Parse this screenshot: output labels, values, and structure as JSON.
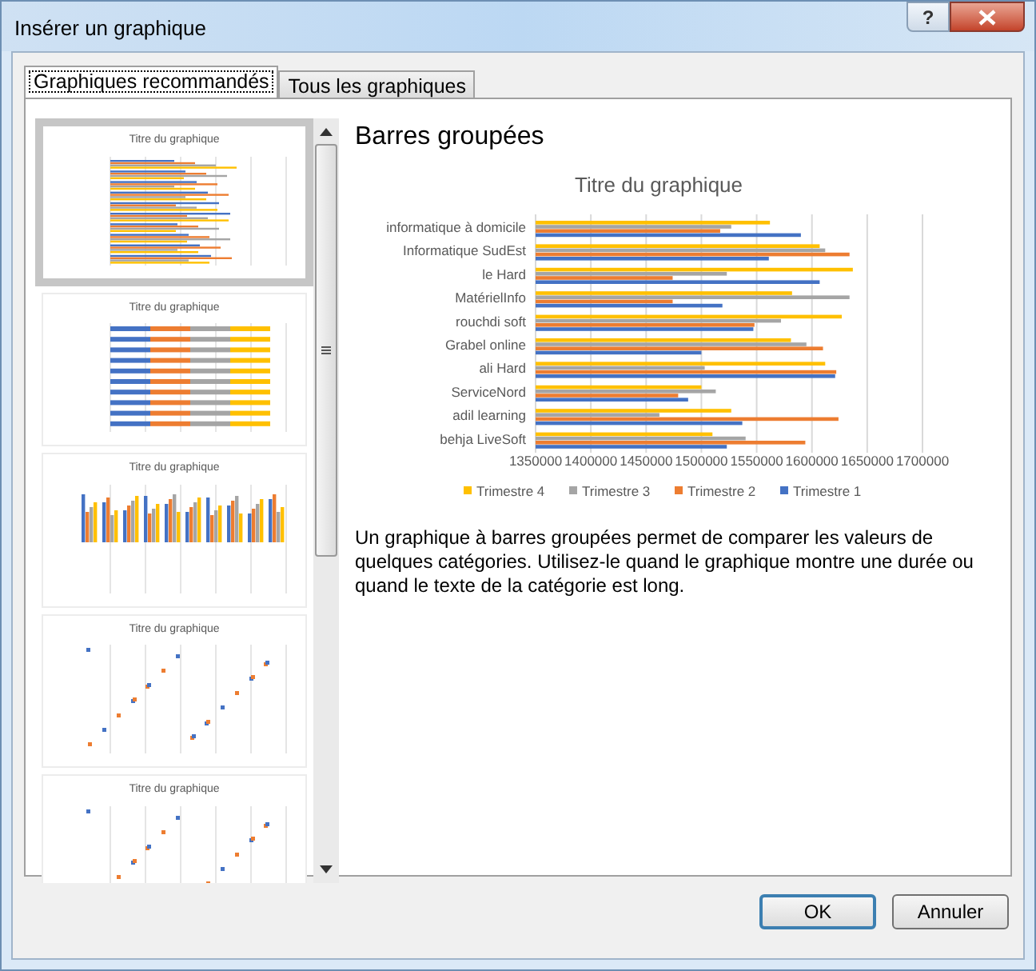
{
  "window": {
    "title": "Insérer un graphique",
    "help_button": "?"
  },
  "tabs": [
    {
      "label": "Graphiques recommandés",
      "selected": true
    },
    {
      "label": "Tous les graphiques",
      "selected": false
    }
  ],
  "thumbnails": [
    {
      "title": "Titre du graphique",
      "kind": "bar_clustered",
      "selected": true
    },
    {
      "title": "Titre du graphique",
      "kind": "bar_stacked",
      "selected": false
    },
    {
      "title": "Titre du graphique",
      "kind": "column",
      "selected": false
    },
    {
      "title": "Titre du graphique",
      "kind": "scatter",
      "selected": false
    },
    {
      "title": "Titre du graphique",
      "kind": "scatter",
      "selected": false
    }
  ],
  "preview": {
    "heading": "Barres groupées",
    "chart_data": {
      "type": "bar",
      "orientation": "horizontal",
      "title": "Titre du graphique",
      "categories": [
        "informatique à domicile",
        "Informatique SudEst",
        "le Hard",
        "MatérielInfo",
        "rouchdi soft",
        "Grabel online",
        "ali Hard",
        "ServiceNord",
        "adil learning",
        "behja LiveSoft"
      ],
      "series": [
        {
          "name": "Trimestre 4",
          "color": "#ffc000",
          "values": [
            1562000,
            1607000,
            1637000,
            1582000,
            1627000,
            1581000,
            1612000,
            1500000,
            1527000,
            1510000
          ]
        },
        {
          "name": "Trimestre 3",
          "color": "#a5a5a5",
          "values": [
            1527000,
            1612000,
            1523000,
            1634000,
            1572000,
            1595000,
            1503000,
            1513000,
            1462000,
            1540000
          ]
        },
        {
          "name": "Trimestre 2",
          "color": "#ed7d31",
          "values": [
            1517000,
            1634000,
            1474000,
            1474000,
            1548000,
            1610000,
            1622000,
            1479000,
            1624000,
            1594000
          ]
        },
        {
          "name": "Trimestre 1",
          "color": "#4472c4",
          "values": [
            1590000,
            1561000,
            1607000,
            1519000,
            1547000,
            1500000,
            1621000,
            1488000,
            1537000,
            1523000
          ]
        }
      ],
      "xlim": [
        1350000,
        1700000
      ],
      "grid": true,
      "legend": true,
      "xticks": [
        1350000,
        1400000,
        1450000,
        1500000,
        1550000,
        1600000,
        1650000,
        1700000
      ]
    },
    "description": "Un graphique à barres groupées permet de comparer les valeurs de quelques catégories. Utilisez-le quand le graphique montre une durée ou quand le texte de la catégorie est long."
  },
  "buttons": [
    {
      "label": "OK",
      "default": true
    },
    {
      "label": "Annuler",
      "default": false
    }
  ]
}
